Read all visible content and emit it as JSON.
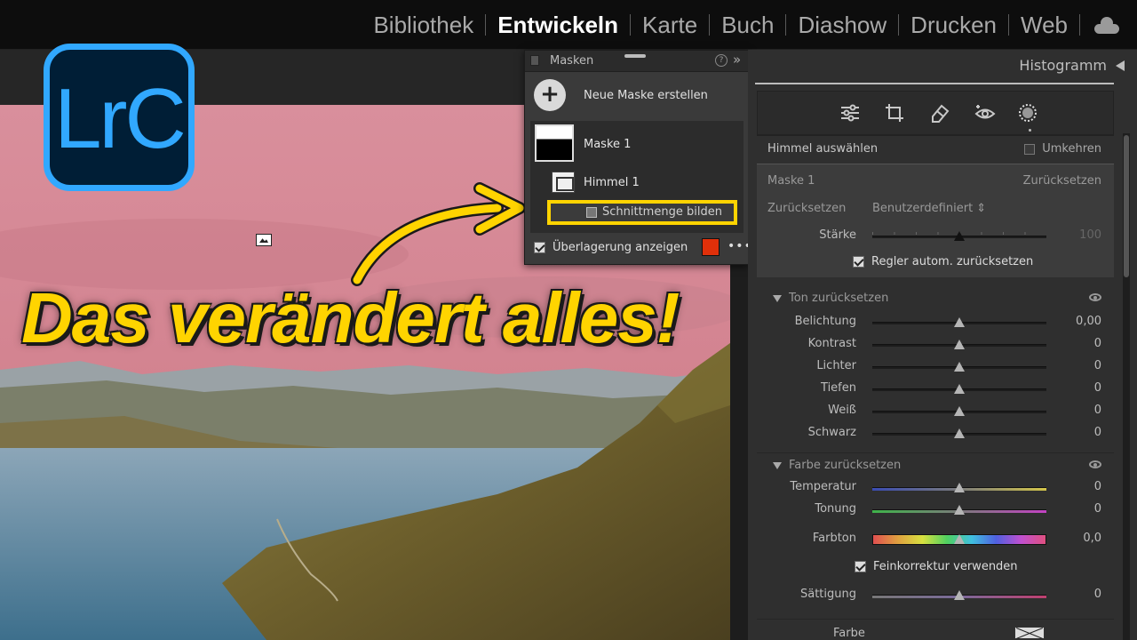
{
  "app": {
    "logo_text": "LrC"
  },
  "modules": [
    "Bibliothek",
    "Entwickeln",
    "Karte",
    "Buch",
    "Diashow",
    "Drucken",
    "Web"
  ],
  "active_module": "Entwickeln",
  "headline": "Das verändert alles!",
  "masks_panel": {
    "title": "Masken",
    "new_mask_label": "Neue Maske erstellen",
    "mask_name": "Maske 1",
    "component_name": "Himmel 1",
    "intersect_label": "Schnittmenge bilden",
    "overlay_label": "Überlagerung anzeigen",
    "overlay_checked": true,
    "overlay_color": "#e0300a"
  },
  "right_panel": {
    "histogram_label": "Histogramm",
    "tools": [
      "sliders-icon",
      "crop-icon",
      "eraser-icon",
      "redeye-icon",
      "masking-icon"
    ],
    "sky_select_label": "Himmel auswählen",
    "invert_label": "Umkehren",
    "mask_section": {
      "name": "Maske 1",
      "reset_link": "Zurücksetzen",
      "reset_label": "Zurücksetzen",
      "preset_value": "Benutzerdefiniert",
      "strength_label": "Stärke",
      "strength_value": "100",
      "auto_reset_label": "Regler autom. zurücksetzen"
    },
    "tone_section": {
      "title": "Ton zurücksetzen",
      "sliders": [
        {
          "label": "Belichtung",
          "value": "0,00"
        },
        {
          "label": "Kontrast",
          "value": "0"
        },
        {
          "label": "Lichter",
          "value": "0"
        },
        {
          "label": "Tiefen",
          "value": "0"
        },
        {
          "label": "Weiß",
          "value": "0"
        },
        {
          "label": "Schwarz",
          "value": "0"
        }
      ]
    },
    "color_section": {
      "title": "Farbe zurücksetzen",
      "sliders": [
        {
          "label": "Temperatur",
          "value": "0"
        },
        {
          "label": "Tonung",
          "value": "0"
        },
        {
          "label": "Farbton",
          "value": "0,0"
        }
      ],
      "fine_label": "Feinkorrektur verwenden",
      "saturation_label": "Sättigung",
      "saturation_value": "0",
      "color_label": "Farbe"
    }
  },
  "colors": {
    "accent_yellow": "#ffd400",
    "lrc_blue": "#31a8ff"
  }
}
